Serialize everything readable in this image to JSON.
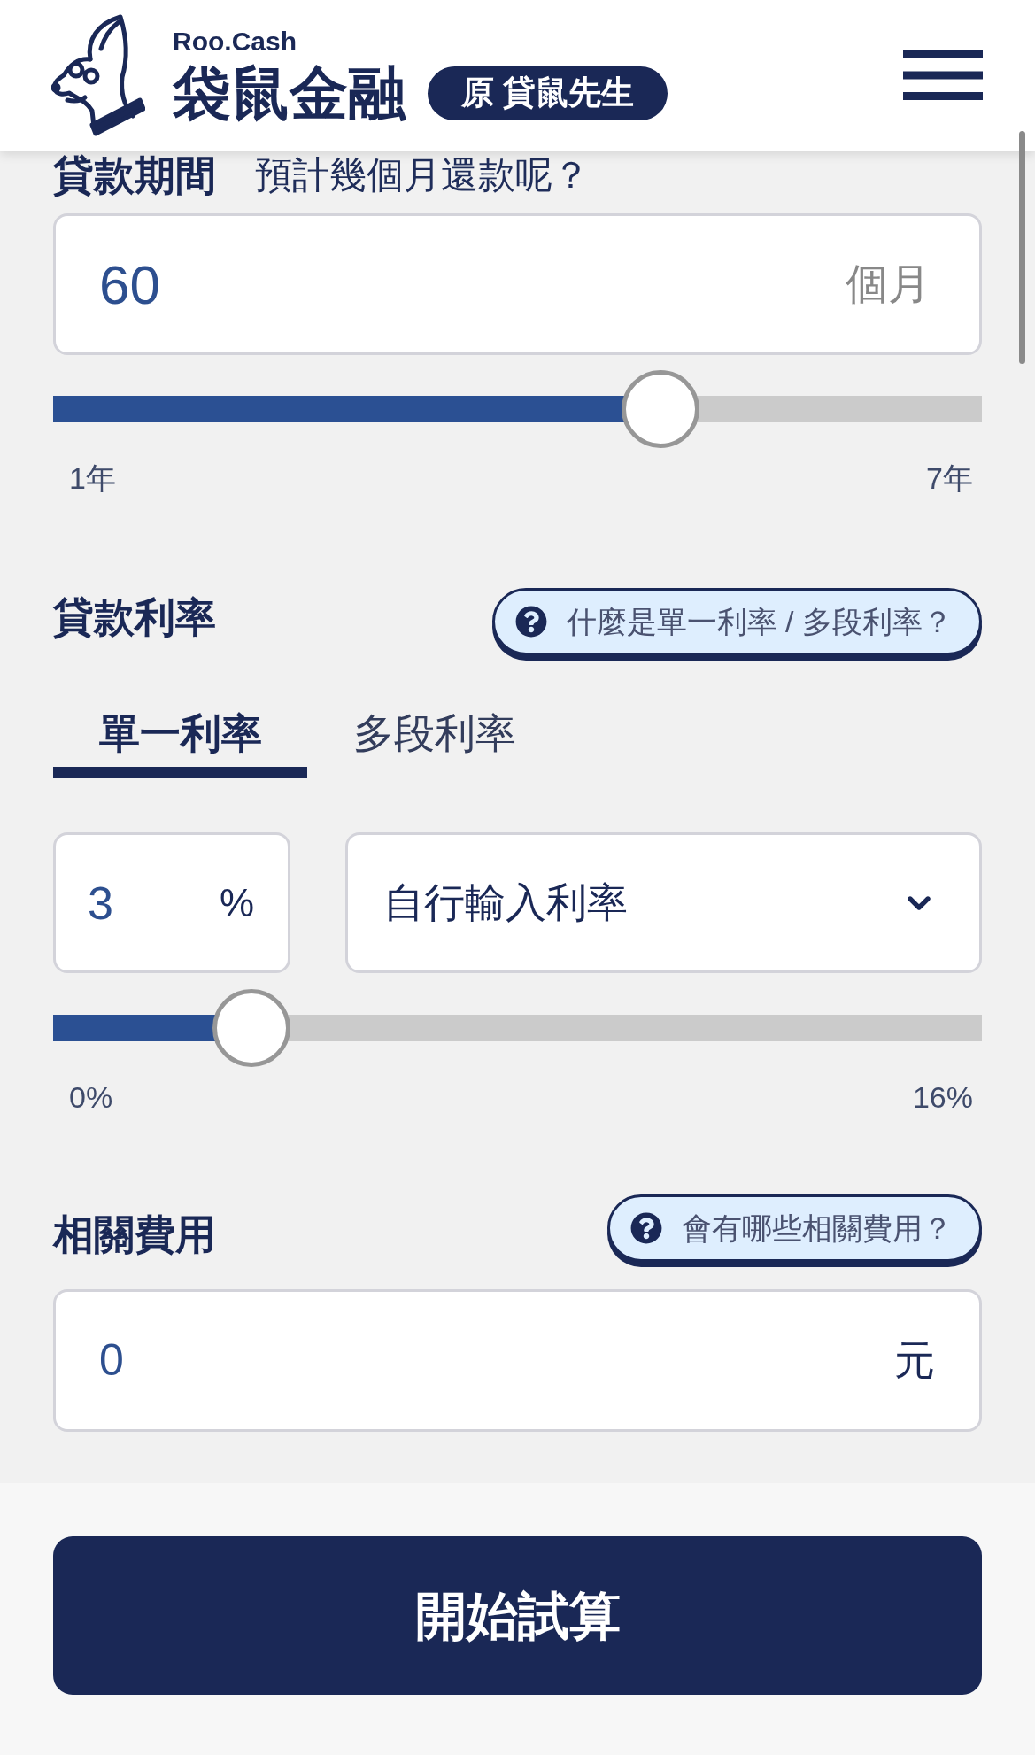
{
  "header": {
    "logo": {
      "brand_en": "Roo.Cash",
      "brand_zh": "袋鼠金融"
    },
    "badge": "原 貸鼠先生"
  },
  "loan_period": {
    "title": "貸款期間",
    "subtitle": "預計幾個月還款呢？",
    "input": {
      "value": "60",
      "unit": "個月"
    },
    "slider": {
      "level": 0.667,
      "min_label": "1年",
      "max_label": "7年"
    }
  },
  "interest_rate": {
    "title": "貸款利率",
    "help": "什麼是單一利率 / 多段利率？",
    "tabs": [
      {
        "label": "單一利率",
        "selected": true
      },
      {
        "label": "多段利率",
        "selected": false
      }
    ],
    "rate_input": {
      "value": "3",
      "unit": "%"
    },
    "rate_source": {
      "value": "自行輸入利率"
    },
    "slider": {
      "level": 0.1875,
      "min_label": "0%",
      "max_label": "16%"
    }
  },
  "fees": {
    "title": "相關費用",
    "help": "會有哪些相關費用？",
    "input": {
      "value": "0",
      "unit": "元"
    }
  },
  "submit_button": "開始試算"
}
